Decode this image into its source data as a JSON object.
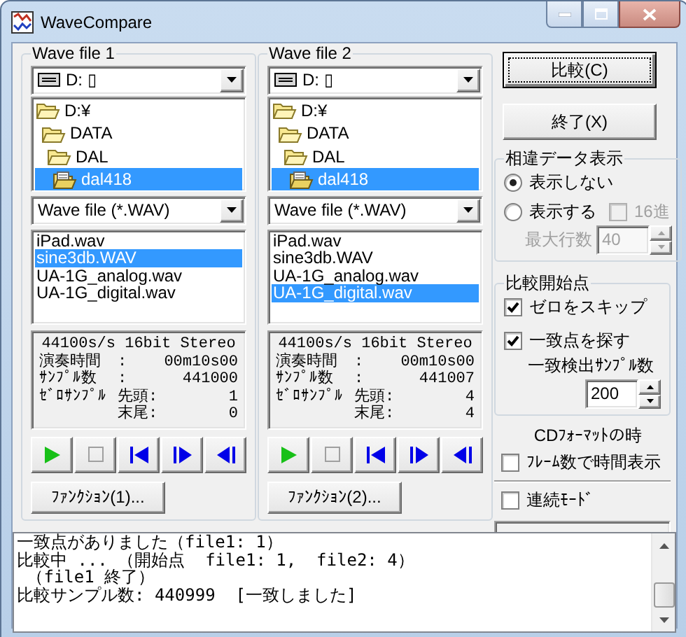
{
  "window": {
    "title": "WaveCompare"
  },
  "panels": [
    {
      "title": "Wave file 1",
      "drive": "D: ▯",
      "folders": [
        {
          "name": "D:¥",
          "selected": false,
          "children": [
            {
              "name": "DATA",
              "selected": false,
              "children": [
                {
                  "name": "DAL",
                  "selected": false,
                  "children": [
                    {
                      "name": "dal418",
                      "selected": true
                    }
                  ]
                }
              ]
            }
          ]
        }
      ],
      "filter": "Wave file (*.WAV)",
      "files": [
        {
          "name": "iPad.wav",
          "selected": false
        },
        {
          "name": "sine3db.WAV",
          "selected": true
        },
        {
          "name": "UA-1G_analog.wav",
          "selected": false
        },
        {
          "name": "UA-1G_digital.wav",
          "selected": false
        }
      ],
      "format": "44100s/s 16bit Stereo",
      "info": [
        {
          "label": "演奏時間",
          "key": ":",
          "value": "00m10s00"
        },
        {
          "label": "ｻﾝﾌﾟﾙ数",
          "key": ":",
          "value": "441000"
        },
        {
          "label": "ｾﾞﾛｻﾝﾌﾟﾙ",
          "key": "先頭:",
          "value": "1"
        },
        {
          "key": "末尾:",
          "value": "0"
        }
      ],
      "transport": [
        {
          "kind": "play",
          "disabled": false
        },
        {
          "kind": "stop",
          "disabled": true
        },
        {
          "kind": "first",
          "disabled": false
        },
        {
          "kind": "next",
          "disabled": false
        },
        {
          "kind": "last",
          "disabled": false
        }
      ],
      "function_button": "ﾌｧﾝｸｼｮﾝ(1)..."
    },
    {
      "title": "Wave file 2",
      "drive": "D: ▯",
      "folders": [
        {
          "name": "D:¥",
          "selected": false,
          "children": [
            {
              "name": "DATA",
              "selected": false,
              "children": [
                {
                  "name": "DAL",
                  "selected": false,
                  "children": [
                    {
                      "name": "dal418",
                      "selected": true
                    }
                  ]
                }
              ]
            }
          ]
        }
      ],
      "filter": "Wave file (*.WAV)",
      "files": [
        {
          "name": "iPad.wav",
          "selected": false
        },
        {
          "name": "sine3db.WAV",
          "selected": false
        },
        {
          "name": "UA-1G_analog.wav",
          "selected": false
        },
        {
          "name": "UA-1G_digital.wav",
          "selected": true
        }
      ],
      "format": "44100s/s 16bit Stereo",
      "info": [
        {
          "label": "演奏時間",
          "key": ":",
          "value": "00m10s00"
        },
        {
          "label": "ｻﾝﾌﾟﾙ数",
          "key": ":",
          "value": "441007"
        },
        {
          "label": "ｾﾞﾛｻﾝﾌﾟﾙ",
          "key": "先頭:",
          "value": "4"
        },
        {
          "key": "末尾:",
          "value": "4"
        }
      ],
      "transport": [
        {
          "kind": "play",
          "disabled": false
        },
        {
          "kind": "stop",
          "disabled": true
        },
        {
          "kind": "first",
          "disabled": false
        },
        {
          "kind": "next",
          "disabled": false
        },
        {
          "kind": "last",
          "disabled": false
        }
      ],
      "function_button": "ﾌｧﾝｸｼｮﾝ(2)..."
    }
  ],
  "actions": [
    {
      "label": "比較(C)",
      "default": true
    },
    {
      "label": "終了(X)",
      "default": false
    }
  ],
  "diff_display": {
    "title": "相違データ表示",
    "options": [
      {
        "label": "表示しない",
        "selected": true
      },
      {
        "label": "表示する",
        "selected": false
      }
    ],
    "hex": {
      "label": "16進",
      "checked": false,
      "disabled": true
    },
    "max_rows": {
      "label": "最大行数",
      "value": "40",
      "disabled": true
    }
  },
  "start_point": {
    "title": "比較開始点",
    "skip_zero": {
      "label": "ゼロをスキップ",
      "checked": true
    },
    "find_match": {
      "label": "一致点を探す",
      "checked": true
    },
    "match_samples": {
      "label": "一致検出ｻﾝﾌﾟﾙ数",
      "value": "200",
      "disabled": false
    }
  },
  "cd_format": {
    "caption": "CDﾌｫｰﾏｯﾄの時",
    "label": "ﾌﾚｰﾑ数で時間表示",
    "checked": false
  },
  "continuous": {
    "label": "連続ﾓｰﾄﾞ",
    "checked": false
  },
  "log": [
    "一致点がありました（file1: 1）",
    "比較中 ... （開始点  file1: 1,  file2: 4）",
    " （file1 終了）",
    "比較サンプル数: 440999  [一致しました]"
  ]
}
